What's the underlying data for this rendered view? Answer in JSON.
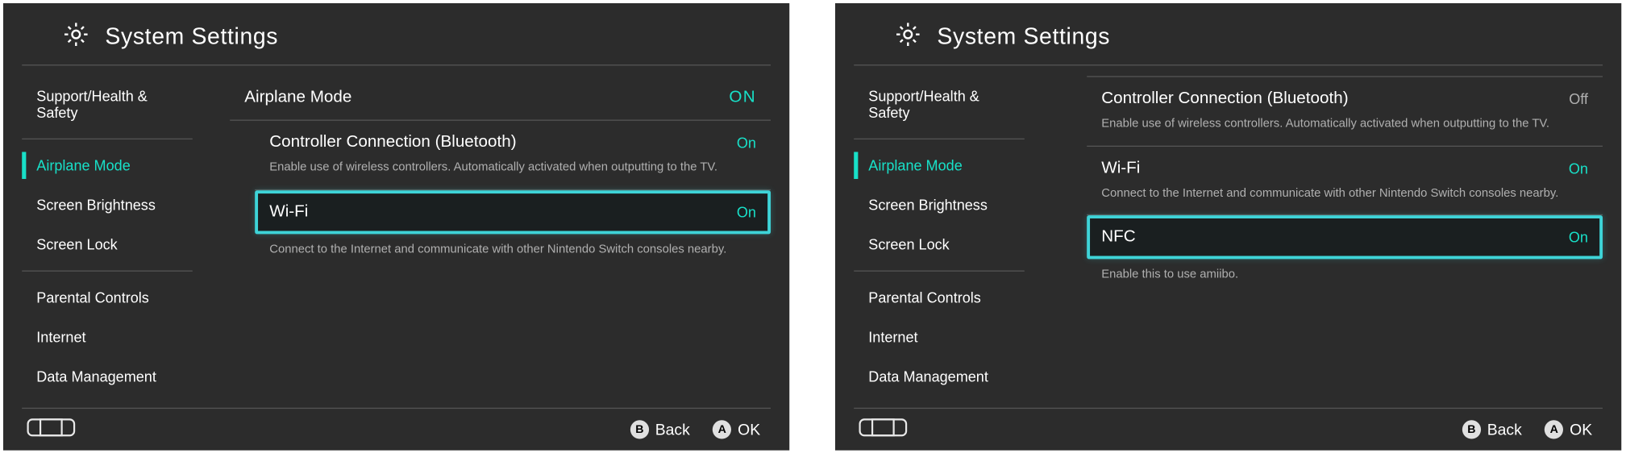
{
  "screens": [
    {
      "header": {
        "title": "System Settings"
      },
      "sidebar": {
        "groups": [
          {
            "items": [
              "Support/Health & Safety"
            ]
          },
          {
            "items": [
              "Airplane Mode",
              "Screen Brightness",
              "Screen Lock"
            ],
            "activeIndex": 0
          },
          {
            "items": [
              "Parental Controls",
              "Internet",
              "Data Management"
            ]
          }
        ]
      },
      "content": {
        "items": [
          {
            "label": "Airplane Mode",
            "value": "ON",
            "valueClass": "big-on",
            "indented": false
          },
          {
            "label": "Controller Connection (Bluetooth)",
            "value": "On",
            "valueClass": "on",
            "desc": "Enable use of wireless controllers. Automatically activated when outputting to the TV.",
            "indented": true
          },
          {
            "label": "Wi-Fi",
            "value": "On",
            "valueClass": "on",
            "selected": true,
            "indented": true,
            "desc": "Connect to the Internet and communicate with other Nintendo Switch consoles nearby."
          }
        ]
      },
      "footer": {
        "buttons": [
          {
            "icon": "B",
            "label": "Back"
          },
          {
            "icon": "A",
            "label": "OK"
          }
        ]
      }
    },
    {
      "header": {
        "title": "System Settings"
      },
      "sidebar": {
        "groups": [
          {
            "items": [
              "Support/Health & Safety"
            ]
          },
          {
            "items": [
              "Airplane Mode",
              "Screen Brightness",
              "Screen Lock"
            ],
            "activeIndex": 0
          },
          {
            "items": [
              "Parental Controls",
              "Internet",
              "Data Management"
            ]
          }
        ]
      },
      "content": {
        "items": [
          {
            "label": "Controller Connection (Bluetooth)",
            "value": "Off",
            "valueClass": "off",
            "desc": "Enable use of wireless controllers. Automatically activated when outputting to the TV.",
            "indented": true
          },
          {
            "label": "Wi-Fi",
            "value": "On",
            "valueClass": "on",
            "desc": "Connect to the Internet and communicate with other Nintendo Switch consoles nearby.",
            "indented": true
          },
          {
            "label": "NFC",
            "value": "On",
            "valueClass": "on",
            "selected": true,
            "indented": true,
            "desc": "Enable this to use amiibo."
          }
        ]
      },
      "footer": {
        "buttons": [
          {
            "icon": "B",
            "label": "Back"
          },
          {
            "icon": "A",
            "label": "OK"
          }
        ]
      }
    }
  ]
}
